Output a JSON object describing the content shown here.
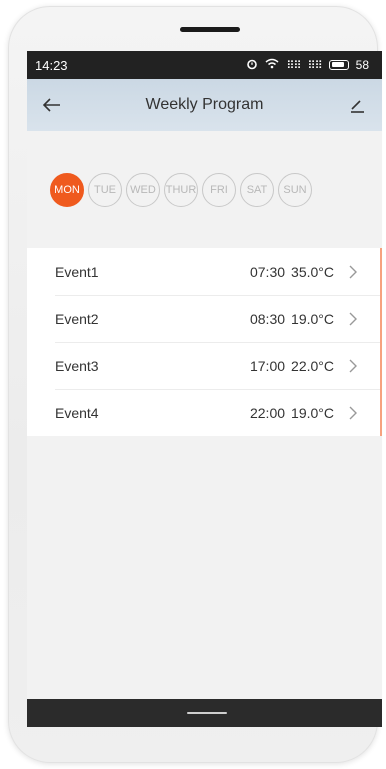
{
  "status": {
    "time": "14:23",
    "battery": "58"
  },
  "header": {
    "title": "Weekly Program"
  },
  "days": [
    "MON",
    "TUE",
    "WED",
    "THUR",
    "FRI",
    "SAT",
    "SUN"
  ],
  "selected_day": "MON",
  "colors": {
    "accent": "#ef5a1e",
    "appbar": "#d2dde8"
  },
  "events": [
    {
      "name": "Event1",
      "time": "07:30",
      "temp": "35.0°C"
    },
    {
      "name": "Event2",
      "time": "08:30",
      "temp": "19.0°C"
    },
    {
      "name": "Event3",
      "time": "17:00",
      "temp": "22.0°C"
    },
    {
      "name": "Event4",
      "time": "22:00",
      "temp": "19.0°C"
    }
  ],
  "icons": {
    "back": "arrow-left-icon",
    "edit": "pencil-icon",
    "row": "chevron-right-icon"
  }
}
